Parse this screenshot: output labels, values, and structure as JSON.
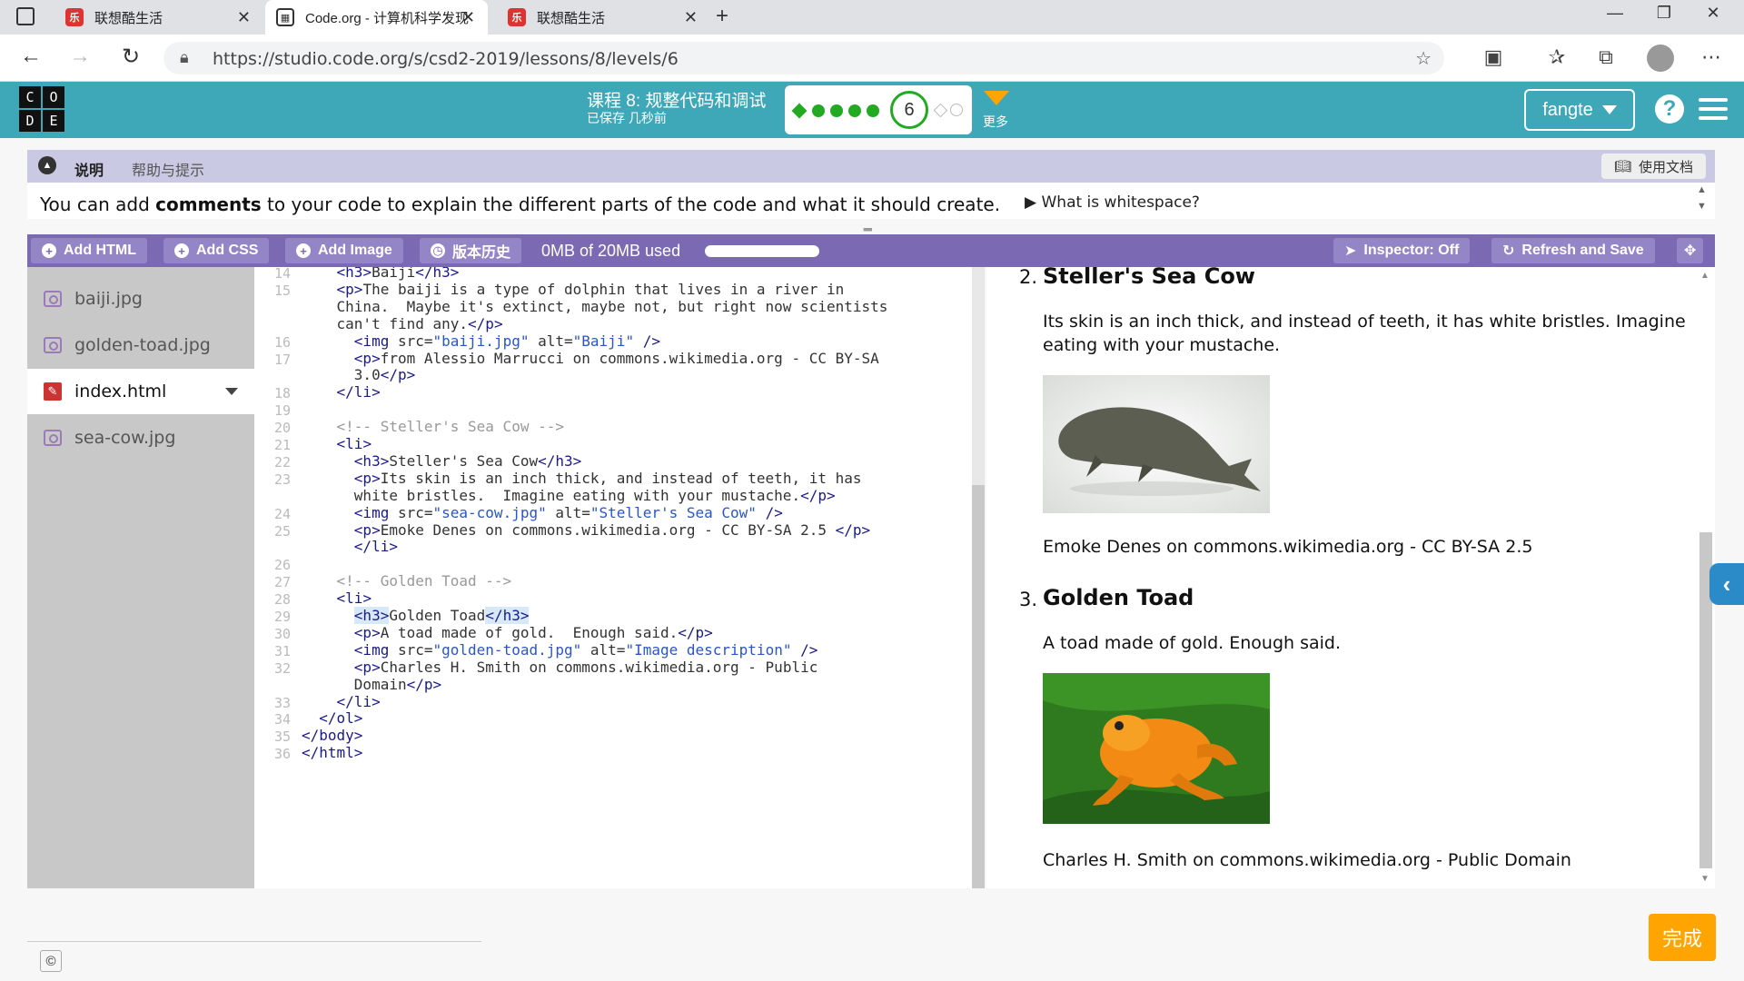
{
  "browser": {
    "tabs": [
      {
        "title": "联想酷生活",
        "active": false
      },
      {
        "title": "Code.org - 计算机科学发现单元2",
        "active": true
      },
      {
        "title": "联想酷生活",
        "active": false
      }
    ],
    "url": "https://studio.code.org/s/csd2-2019/lessons/8/levels/6"
  },
  "header": {
    "logo_letters": [
      "C",
      "O",
      "D",
      "E"
    ],
    "lesson_title": "课程 8: 规整代码和调试",
    "saved_status": "已保存 几秒前",
    "current_level": "6",
    "more_label": "更多",
    "user_name": "fangte",
    "help_glyph": "?"
  },
  "instructions": {
    "tabs": [
      "说明",
      "帮助与提示"
    ],
    "doc_button": "使用文档",
    "text_before": "You can add ",
    "text_bold": "comments",
    "text_after": " to your code to explain the different parts of the code and what it should create.",
    "hint": "What is whitespace?"
  },
  "toolbar": {
    "add_html": "Add HTML",
    "add_css": "Add CSS",
    "add_image": "Add Image",
    "version_history": "版本历史",
    "usage": "0MB of 20MB used",
    "usage_fraction": 0.0,
    "inspector": "Inspector: Off",
    "refresh": "Refresh and Save"
  },
  "files": [
    "baiji.jpg",
    "golden-toad.jpg",
    "index.html",
    "sea-cow.jpg"
  ],
  "code": {
    "line_numbers": [
      "14",
      "15",
      "",
      "",
      "16",
      "17",
      "",
      "18",
      "19",
      "20",
      "21",
      "22",
      "23",
      "",
      "24",
      "25",
      "",
      "26",
      "27",
      "28",
      "29",
      "30",
      "31",
      "32",
      "",
      "33",
      "34",
      "35",
      "36"
    ],
    "lines": [
      "    <h3>Baiji</h3>",
      "    <p>The baiji is a type of dolphin that lives in a river in",
      "    China.  Maybe it's extinct, maybe not, but right now scientists",
      "    can't find any.</p>",
      "      <img src=\"baiji.jpg\" alt=\"Baiji\" />",
      "      <p>from Alessio Marrucci on commons.wikimedia.org - CC BY-SA",
      "      3.0</p>",
      "    </li>",
      "",
      "    <!-- Steller's Sea Cow -->",
      "    <li>",
      "      <h3>Steller's Sea Cow</h3>",
      "      <p>Its skin is an inch thick, and instead of teeth, it has",
      "      white bristles.  Imagine eating with your mustache.</p>",
      "      <img src=\"sea-cow.jpg\" alt=\"Steller's Sea Cow\" />",
      "      <p>Emoke Denes on commons.wikimedia.org - CC BY-SA 2.5 </p>",
      "      </li>",
      "",
      "    <!-- Golden Toad -->",
      "    <li>",
      "      <h3>Golden Toad</h3>",
      "      <p>A toad made of gold.  Enough said.</p>",
      "      <img src=\"golden-toad.jpg\" alt=\"Image description\" />",
      "      <p>Charles H. Smith on commons.wikimedia.org - Public",
      "      Domain</p>",
      "    </li>",
      "  </ol>",
      "</body>",
      "</html>"
    ]
  },
  "preview": {
    "items": [
      {
        "num": "2.",
        "title": "Steller's Sea Cow",
        "text_1": "Its skin is an inch thick, and instead of teeth, it has white bristles. Imagine",
        "text_2": "eating with your mustache.",
        "credit": "Emoke Denes on commons.wikimedia.org - CC BY-SA 2.5"
      },
      {
        "num": "3.",
        "title": "Golden Toad",
        "text_1": "A toad made of gold. Enough said.",
        "credit": "Charles H. Smith on commons.wikimedia.org - Public Domain"
      }
    ]
  },
  "finish_button": "完成",
  "copyright": "©"
}
